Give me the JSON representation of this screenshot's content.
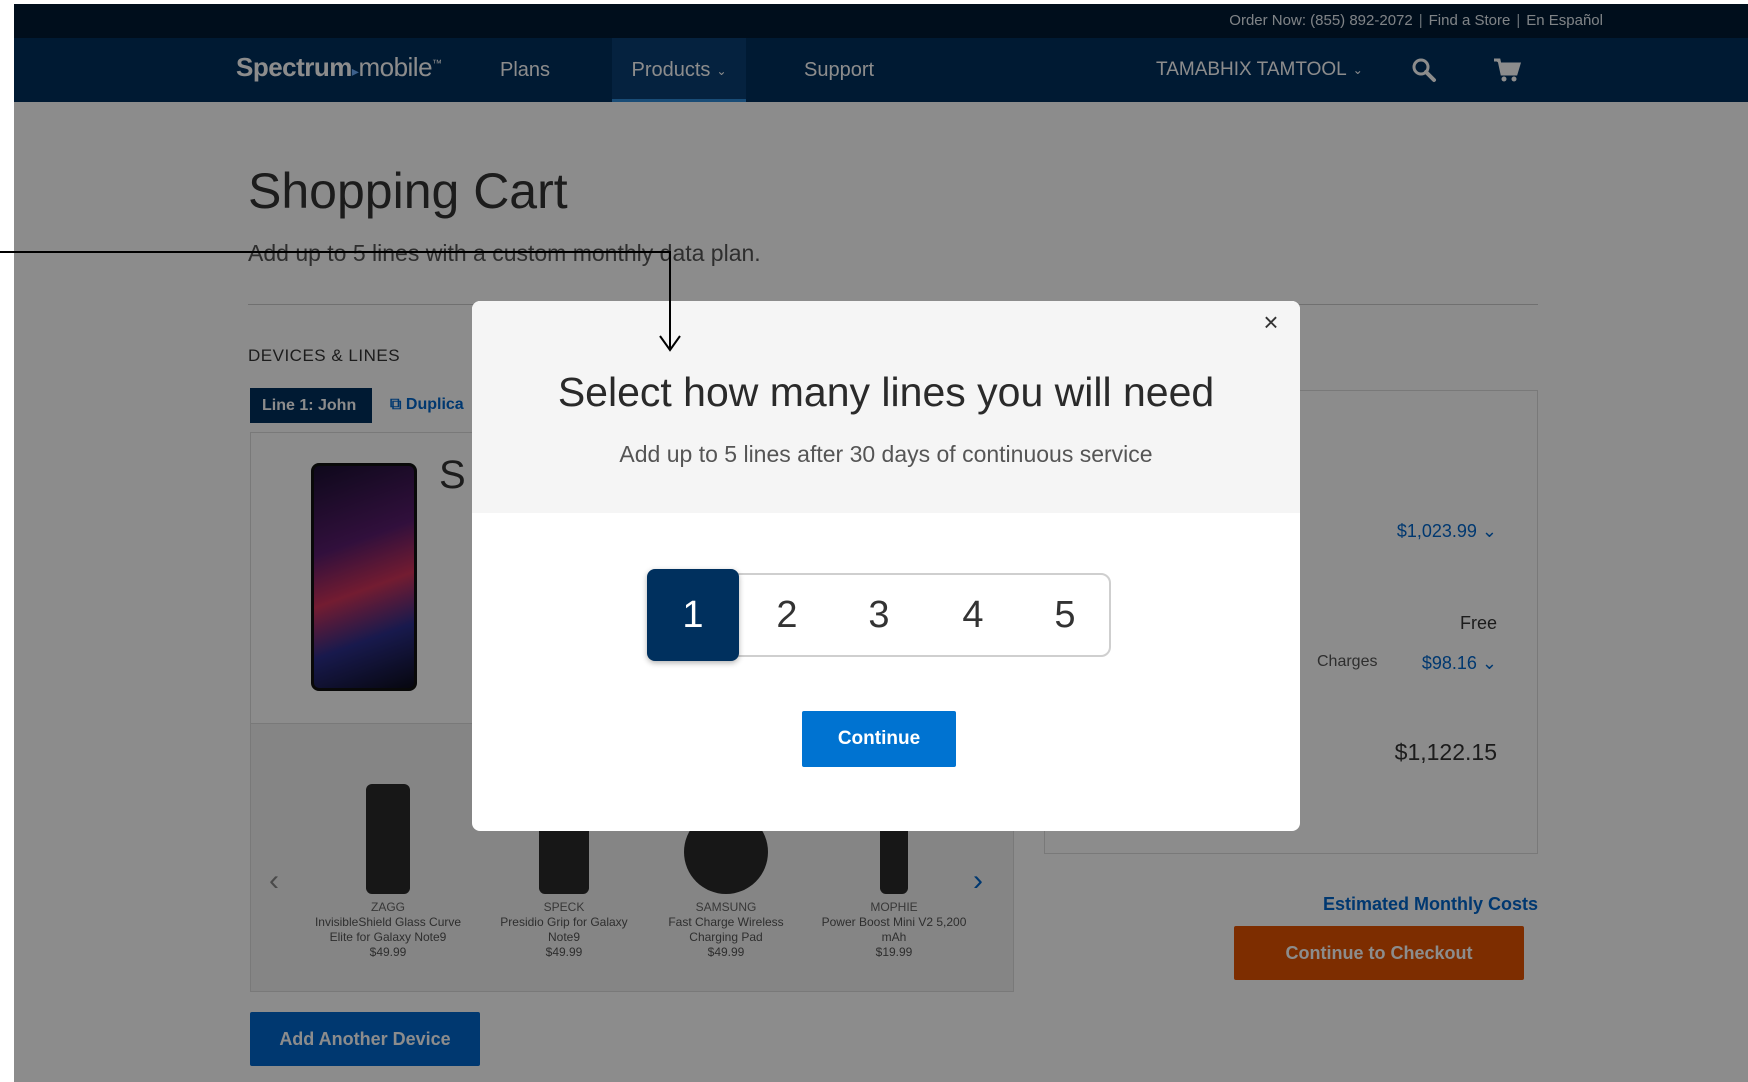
{
  "utility_bar": {
    "order_now": "Order Now: (855) 892-2072",
    "find_store": "Find a Store",
    "espanol": "En Español",
    "separator": "|"
  },
  "nav": {
    "logo_bold": "Spectrum",
    "logo_light": "mobile",
    "plans": "Plans",
    "products": "Products",
    "support": "Support",
    "account": "TAMABHIX TAMTOOL",
    "search_icon": "search-icon",
    "cart_icon": "cart-icon"
  },
  "page": {
    "title": "Shopping Cart",
    "subtitle": "Add up to 5 lines with a custom monthly data plan.",
    "devices_label": "DEVICES & LINES",
    "line_tab": "Line 1: John",
    "duplicate": "Duplica",
    "device_letter": "S",
    "add_device": "Add Another Device",
    "accessories": [
      {
        "brand": "ZAGG",
        "name": "InvisibleShield Glass Curve Elite for Galaxy Note9",
        "price": "$49.99"
      },
      {
        "brand": "SPECK",
        "name": "Presidio Grip for Galaxy Note9",
        "price": "$49.99"
      },
      {
        "brand": "SAMSUNG",
        "name": "Fast Charge Wireless Charging Pad",
        "price": "$49.99"
      },
      {
        "brand": "MOPHIE",
        "name": "Power Boost Mini V2 5,200 mAh",
        "price": "$19.99"
      }
    ]
  },
  "summary": {
    "device_total": "$1,023.99",
    "free": "Free",
    "charges_label": "Charges",
    "charges_value": "$98.16",
    "total": "$1,122.15",
    "estimated_link": "Estimated Monthly Costs",
    "checkout": "Continue to Checkout"
  },
  "modal": {
    "title": "Select how many lines you will need",
    "subtitle": "Add up to 5 lines after 30 days of continuous service",
    "options": [
      "1",
      "2",
      "3",
      "4",
      "5"
    ],
    "selected": "1",
    "continue": "Continue",
    "close": "×"
  },
  "colors": {
    "nav_bg": "#00305e",
    "accent_blue": "#0073d1",
    "checkout_orange": "#e35300"
  }
}
